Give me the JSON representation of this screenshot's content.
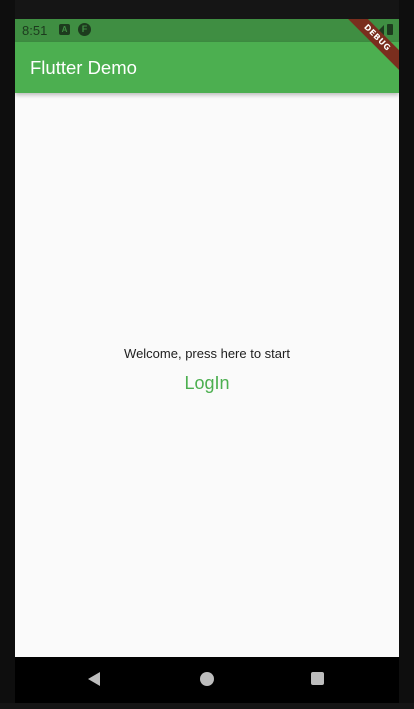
{
  "status_bar": {
    "time": "8:51",
    "icons": [
      "notification-a-icon",
      "notification-f-icon",
      "wifi-icon",
      "signal-icon",
      "battery-icon"
    ],
    "background": "#3f8e42"
  },
  "app_bar": {
    "title": "Flutter Demo",
    "background": "#4caf50"
  },
  "debug_banner": {
    "label": "DEBUG"
  },
  "body": {
    "welcome_text": "Welcome, press here to start",
    "login_label": "LogIn",
    "accent": "#4caf50"
  },
  "nav_bar": {
    "icons": [
      "back-icon",
      "home-icon",
      "recent-apps-icon"
    ]
  }
}
